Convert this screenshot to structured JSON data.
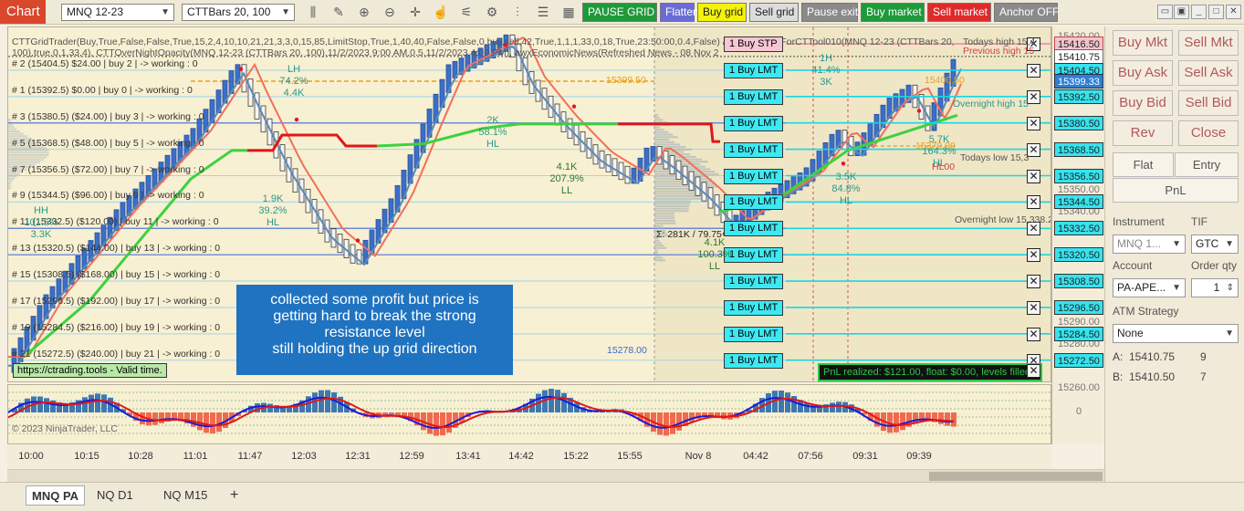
{
  "toolbar": {
    "chart_label": "Chart",
    "instrument": "MNQ 12-23",
    "bars_type": "CTTBars 20, 100",
    "buttons": [
      {
        "label": "PAUSE GRID",
        "bg": "#1e9a3a",
        "fg": "#ffffff"
      },
      {
        "label": "Flatten",
        "bg": "#6b6bd6",
        "fg": "#ffffff"
      },
      {
        "label": "Buy grid",
        "bg": "#f2f20c",
        "fg": "#222222"
      },
      {
        "label": "Sell grid",
        "bg": "#dcdcdc",
        "fg": "#222222"
      },
      {
        "label": "Pause exit",
        "bg": "#8a8a8a",
        "fg": "#ffffff"
      },
      {
        "label": "Buy market",
        "bg": "#1e9a3a",
        "fg": "#ffffff"
      },
      {
        "label": "Sell market",
        "bg": "#e02a2a",
        "fg": "#ffffff"
      },
      {
        "label": "Anchor OFF",
        "bg": "#8a8a8a",
        "fg": "#ffffff"
      }
    ],
    "icons": [
      "bar-style-icon",
      "draw-pencil-icon",
      "zoom-in-icon",
      "zoom-out-icon",
      "crosshair-icon",
      "hand-icon",
      "chart-properties-icon",
      "indicators-icon",
      "strategies-icon",
      "templates-icon",
      "data-box-icon"
    ]
  },
  "chart": {
    "header_line1": "CTTGridTrader(Buy,True,False,False,True,15,2,4,10,10,21,21,3,3,0,15,85,LimitStop,True,1,40,40,False,False,0,buy,sell,42,True,1,1,1,33,0,18,True,23:50:00,0.4,False) / CTTStepMAForCTTool010(MNQ 12-23 (CTTBars 20,",
    "header_line2": "100),true,0,1,33,4), CTTOverNightOpacity(MNQ 12-23 (CTTBars 20, 100),11/2/2023 9:00 AM,0.5,11/2/2023 4:00 PM), awxEconomicNews(Refreshed News - 08 Nov 2",
    "grid_levels": [
      {
        "label": "# 2 (15404.5) $24.00 | buy 2 | -> working : 0"
      },
      {
        "label": "# 1 (15392.5) $0.00 | buy 0 | -> working : 0"
      },
      {
        "label": "# 3 (15380.5) ($24.00) | buy 3 | -> working : 0"
      },
      {
        "label": "# 5 (15368.5) ($48.00) | buy 5 | -> working : 0"
      },
      {
        "label": "# 7 (15356.5) ($72.00) | buy 7 | -> working : 0"
      },
      {
        "label": "# 9 (15344.5) ($96.00) | buy 9 | -> working : 0"
      },
      {
        "label": "# 11 (15332.5) ($120.00) | buy 11 | -> working : 0"
      },
      {
        "label": "# 13 (15320.5) ($144.00) | buy 13 | -> working : 0"
      },
      {
        "label": "# 15 (15308.5) ($168.00) | buy 15 | -> working : 0"
      },
      {
        "label": "# 17 (15296.5) ($192.00) | buy 17 | -> working : 0"
      },
      {
        "label": "# 19 (15284.5) ($216.00) | buy 19 | -> working : 0"
      },
      {
        "label": "# 21 (15272.5) ($240.00) | buy 21 | -> working : 0"
      }
    ],
    "order_buttons": [
      {
        "label": "1 Buy STP",
        "type": "stp"
      },
      {
        "label": "1 Buy LMT",
        "type": "lmt"
      },
      {
        "label": "1 Buy LMT",
        "type": "lmt"
      },
      {
        "label": "1 Buy LMT",
        "type": "lmt"
      },
      {
        "label": "1 Buy LMT",
        "type": "lmt"
      },
      {
        "label": "1 Buy LMT",
        "type": "lmt"
      },
      {
        "label": "1 Buy LMT",
        "type": "lmt"
      },
      {
        "label": "1 Buy LMT",
        "type": "lmt"
      },
      {
        "label": "1 Buy LMT",
        "type": "lmt"
      },
      {
        "label": "1 Buy LMT",
        "type": "lmt"
      },
      {
        "label": "1 Buy LMT",
        "type": "lmt"
      },
      {
        "label": "1 Buy LMT",
        "type": "lmt"
      },
      {
        "label": "1 Buy LMT",
        "type": "lmt"
      }
    ],
    "swing_labels": [
      {
        "lines": [
          "LH",
          "74.2%",
          "4.4K"
        ],
        "color": "#2a9a8a"
      },
      {
        "lines": [
          "1.9K",
          "39.2%",
          "HL"
        ],
        "color": "#2a9a8a"
      },
      {
        "lines": [
          "2K",
          "58.1%",
          "HL"
        ],
        "color": "#2a9a8a"
      },
      {
        "lines": [
          "4.1K",
          "207.9%",
          "LL"
        ],
        "color": "#2a7a2a"
      },
      {
        "lines": [
          "HH",
          "101.5%",
          "3.3K"
        ],
        "color": "#2a9a8a"
      },
      {
        "lines": [
          "3.5K",
          "84.8%",
          "HL"
        ],
        "color": "#2a9a8a"
      },
      {
        "lines": [
          "5.7K",
          "164.3%",
          "HL"
        ],
        "color": "#2a9a8a"
      },
      {
        "lines": [
          "1H",
          "41.4%",
          "3K"
        ],
        "color": "#2a9a8a"
      },
      {
        "lines": [
          "4.1K",
          "100.3%",
          "LL"
        ],
        "color": "#2a7a2a"
      }
    ],
    "annotations": {
      "level_15399": "15399.50",
      "level_15278": "15278.00",
      "level_15370": "15370.00",
      "level_15400": "15400.50",
      "overnight_high": "Overnight high 15",
      "overnight_low": "Overnight low 15,338.2",
      "todays_low": "Todays low 15,3",
      "todays_high": "Todays high 15,4",
      "previous_high": "Previous high 15",
      "volume_text": "Σ: 281K / 79.75",
      "high_low_label": "HL00",
      "copyright": "© 2023 NinjaTrader, LLC"
    },
    "callout": [
      "collected some profit but price is",
      "getting hard to break the strong",
      "resistance level",
      "still holding the up grid direction"
    ],
    "valid_text": "https://ctrading.tools - Valid time.",
    "pnl_text": "PnL realized: $121.00, float: $0.00, levels filled"
  },
  "price_axis": [
    {
      "label": "15416.50",
      "style": "pink"
    },
    {
      "label": "15410.75",
      "style": "box"
    },
    {
      "label": "15404.50",
      "style": "cyan"
    },
    {
      "label": "15399.33",
      "style": "blue"
    },
    {
      "label": "15392.50",
      "style": "cyan"
    },
    {
      "label": "15380.50",
      "style": "cyan"
    },
    {
      "label": "15368.50",
      "style": "cyan"
    },
    {
      "label": "15356.50",
      "style": "cyan"
    },
    {
      "label": "15344.50",
      "style": "cyan"
    },
    {
      "label": "15332.50",
      "style": "cyan"
    },
    {
      "label": "15320.50",
      "style": "cyan"
    },
    {
      "label": "15308.50",
      "style": "cyan"
    },
    {
      "label": "15296.50",
      "style": "cyan"
    },
    {
      "label": "15284.50",
      "style": "cyan"
    },
    {
      "label": "15272.50",
      "style": "cyan"
    },
    {
      "label": "15350.00",
      "style": "plain"
    },
    {
      "label": "15340.00",
      "style": "plain"
    },
    {
      "label": "15290.00",
      "style": "plain"
    },
    {
      "label": "15280.00",
      "style": "plain"
    },
    {
      "label": "15260.00",
      "style": "plain"
    },
    {
      "label": "15420.00",
      "style": "plain"
    }
  ],
  "osc_axis": {
    "zero": "0"
  },
  "time_axis": [
    "10:00",
    "10:15",
    "10:28",
    "11:01",
    "11:47",
    "12:03",
    "12:31",
    "12:59",
    "13:41",
    "14:42",
    "15:22",
    "15:55",
    "Nov 8",
    "04:42",
    "07:56",
    "09:31",
    "09:39"
  ],
  "tabs": {
    "items": [
      {
        "label": "MNQ PA",
        "active": true
      },
      {
        "label": "NQ D1",
        "active": false
      },
      {
        "label": "NQ M15",
        "active": false
      }
    ],
    "add": "+"
  },
  "panel": {
    "buy_mkt": "Buy Mkt",
    "sell_mkt": "Sell Mkt",
    "buy_ask": "Buy Ask",
    "sell_ask": "Sell Ask",
    "buy_bid": "Buy Bid",
    "sell_bid": "Sell Bid",
    "rev": "Rev",
    "close": "Close",
    "flat": "Flat",
    "entry": "Entry",
    "pnl": "PnL",
    "instrument_label": "Instrument",
    "instrument_value": "MNQ 1...",
    "tif_label": "TIF",
    "tif_value": "GTC",
    "account_label": "Account",
    "account_value": "PA-APE...",
    "order_qty_label": "Order qty",
    "order_qty_value": "1",
    "atm_label": "ATM Strategy",
    "atm_value": "None",
    "ask_label": "A:",
    "ask_price": "15410.75",
    "ask_size": "9",
    "bid_label": "B:",
    "bid_price": "15410.50",
    "bid_size": "7"
  },
  "colors": {
    "background": "#f8f0d2",
    "cyan": "#36e3ee",
    "blue": "#2f7fd4",
    "green": "#3ed13e",
    "red": "#e01818",
    "salmon": "#f0705a",
    "steel": "#5a8ab8"
  }
}
